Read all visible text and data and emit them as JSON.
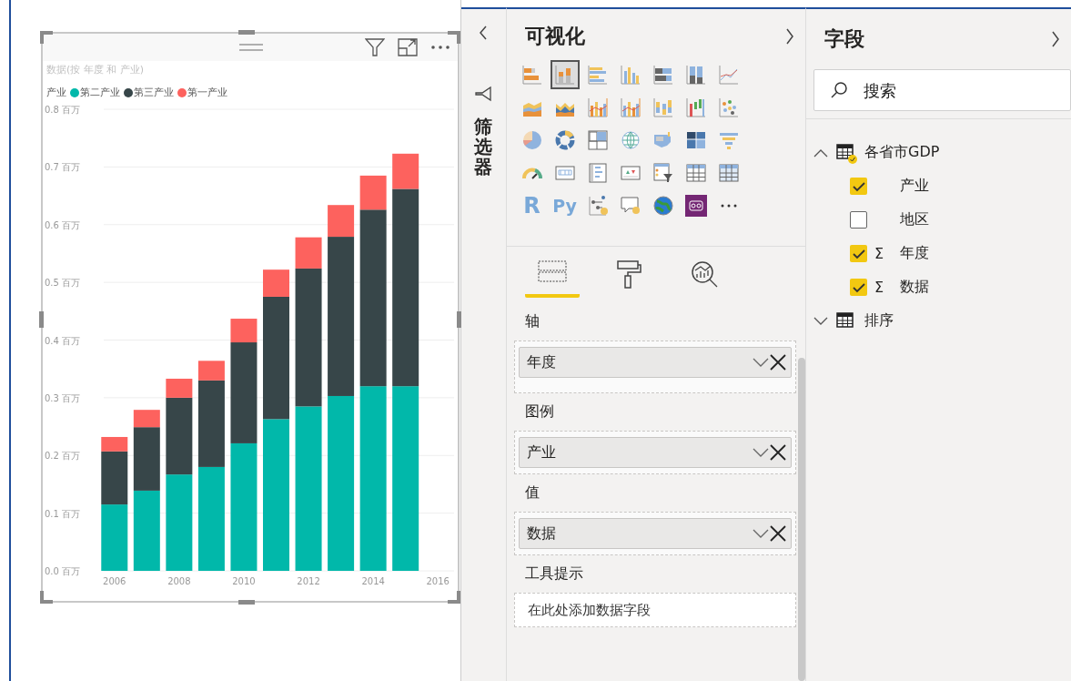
{
  "visual": {
    "title": "数据(按 年度 和 产业)",
    "legend_title": "产业",
    "chart_data": {
      "type": "bar",
      "stacked": true,
      "orientation": "vertical",
      "x": [
        2006,
        2007,
        2008,
        2009,
        2010,
        2011,
        2012,
        2013,
        2014,
        2015
      ],
      "xlim": [
        2005.5,
        2016.5
      ],
      "grid": true,
      "series": [
        {
          "name": "第二产业",
          "color": "#01b8aa",
          "values": [
            0.115,
            0.139,
            0.167,
            0.18,
            0.221,
            0.263,
            0.285,
            0.303,
            0.32,
            0.32
          ]
        },
        {
          "name": "第三产业",
          "color": "#374649",
          "values": [
            0.092,
            0.11,
            0.133,
            0.15,
            0.175,
            0.212,
            0.239,
            0.276,
            0.306,
            0.342
          ]
        },
        {
          "name": "第一产业",
          "color": "#fd625e",
          "values": [
            0.025,
            0.03,
            0.033,
            0.034,
            0.041,
            0.047,
            0.054,
            0.055,
            0.059,
            0.061
          ]
        }
      ],
      "ylim": [
        0,
        0.8
      ],
      "yticks": [
        {
          "value": 0,
          "label": "0.0 百万"
        },
        {
          "value": 0.1,
          "label": "0.1 百万"
        },
        {
          "value": 0.2,
          "label": "0.2 百万"
        },
        {
          "value": 0.3,
          "label": "0.3 百万"
        },
        {
          "value": 0.4,
          "label": "0.4 百万"
        },
        {
          "value": 0.5,
          "label": "0.5 百万"
        },
        {
          "value": 0.6,
          "label": "0.6 百万"
        },
        {
          "value": 0.7,
          "label": "0.7 百万"
        },
        {
          "value": 0.8,
          "label": "0.8 百万"
        }
      ],
      "xticks": [
        2006,
        2008,
        2010,
        2012,
        2014,
        2016
      ]
    }
  },
  "filters": {
    "title": "筛选器"
  },
  "visualizations": {
    "title": "可视化",
    "icons": [
      {
        "kind": "hbar",
        "selected": false
      },
      {
        "kind": "column",
        "selected": true
      },
      {
        "kind": "hbar2",
        "selected": false
      },
      {
        "kind": "column2",
        "selected": false
      },
      {
        "kind": "hbar100",
        "selected": false
      },
      {
        "kind": "column100",
        "selected": false
      },
      {
        "kind": "line",
        "selected": false
      },
      {
        "kind": "area",
        "selected": false
      },
      {
        "kind": "area2",
        "selected": false
      },
      {
        "kind": "combo",
        "selected": false
      },
      {
        "kind": "combo2",
        "selected": false
      },
      {
        "kind": "ribbon",
        "selected": false
      },
      {
        "kind": "waterfall",
        "selected": false
      },
      {
        "kind": "scatter",
        "selected": false
      },
      {
        "kind": "pie",
        "selected": false
      },
      {
        "kind": "donut",
        "selected": false
      },
      {
        "kind": "treemap",
        "selected": false
      },
      {
        "kind": "globe",
        "selected": false
      },
      {
        "kind": "map",
        "selected": false
      },
      {
        "kind": "filledmap",
        "selected": false
      },
      {
        "kind": "funnel",
        "selected": false
      },
      {
        "kind": "gauge",
        "selected": false
      },
      {
        "kind": "card",
        "selected": false
      },
      {
        "kind": "multicard",
        "selected": false
      },
      {
        "kind": "kpi",
        "selected": false
      },
      {
        "kind": "slicer",
        "selected": false
      },
      {
        "kind": "table",
        "selected": false
      },
      {
        "kind": "matrix",
        "selected": false
      },
      {
        "kind": "text",
        "label": "R",
        "selected": false
      },
      {
        "kind": "text",
        "label": "Py",
        "selected": false
      },
      {
        "kind": "tree",
        "selected": false
      },
      {
        "kind": "qa",
        "selected": false
      },
      {
        "kind": "earth",
        "selected": false
      },
      {
        "kind": "custom",
        "selected": false
      },
      {
        "kind": "more",
        "selected": false
      }
    ],
    "pane_tabs": [
      {
        "kind": "fields",
        "selected": true
      },
      {
        "kind": "format",
        "selected": false
      },
      {
        "kind": "analytics",
        "selected": false
      }
    ],
    "wells": [
      {
        "label": "轴",
        "value": "年度"
      },
      {
        "label": "图例",
        "value": "产业"
      },
      {
        "label": "值",
        "value": "数据"
      },
      {
        "label": "工具提示",
        "placeholder": "在此处添加数据字段"
      }
    ]
  },
  "fields": {
    "title": "字段",
    "search": {
      "placeholder": "搜索"
    },
    "tables": [
      {
        "name": "各省市GDP",
        "expanded": true,
        "children": [
          {
            "name": "产业",
            "checked": true
          },
          {
            "name": "地区",
            "checked": false
          },
          {
            "name": "年度",
            "prefix": "Σ",
            "checked": true
          },
          {
            "name": "数据",
            "prefix": "Σ",
            "checked": true
          }
        ]
      },
      {
        "name": "排序",
        "expanded": false
      }
    ]
  }
}
